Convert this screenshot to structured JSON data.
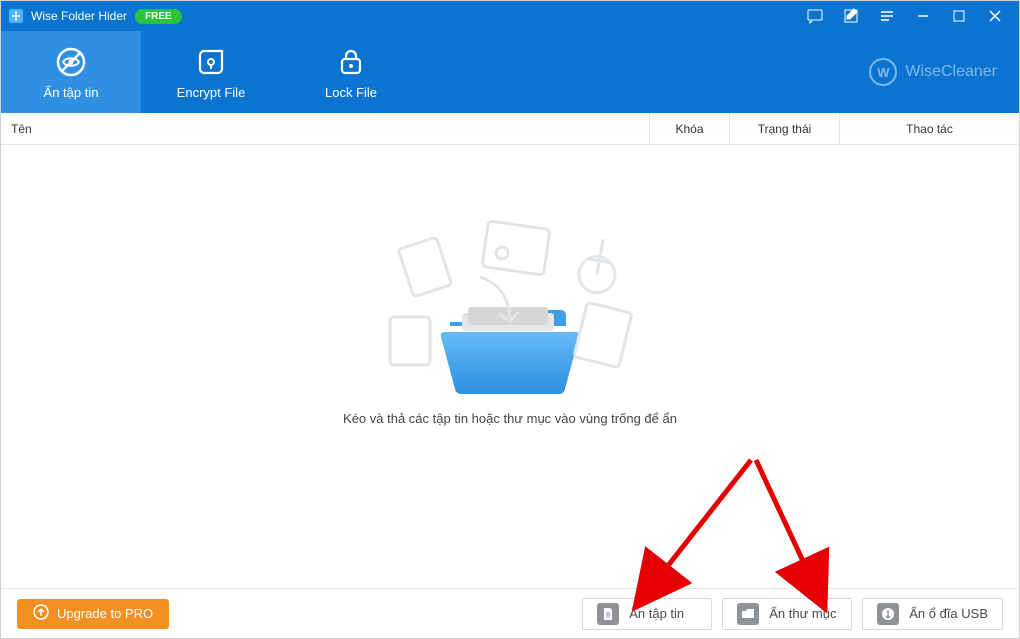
{
  "titlebar": {
    "app_name": "Wise Folder Hider",
    "badge": "FREE"
  },
  "toolbar": {
    "tabs": [
      {
        "label": "Ẩn tập tin"
      },
      {
        "label": "Encrypt File"
      },
      {
        "label": "Lock File"
      }
    ],
    "brand": "WiseCleaner"
  },
  "columns": {
    "name": "Tên",
    "lock": "Khóa",
    "status": "Trạng thái",
    "action": "Thao tác"
  },
  "dropzone": {
    "hint": "Kéo và thả các tập tin hoặc thư mục vào vùng trống để ẩn"
  },
  "bottom": {
    "upgrade": "Upgrade to PRO",
    "hide_file": "Ẩn tập tin",
    "hide_folder": "Ẩn thư mục",
    "hide_usb": "Ẩn ổ đĩa USB"
  }
}
